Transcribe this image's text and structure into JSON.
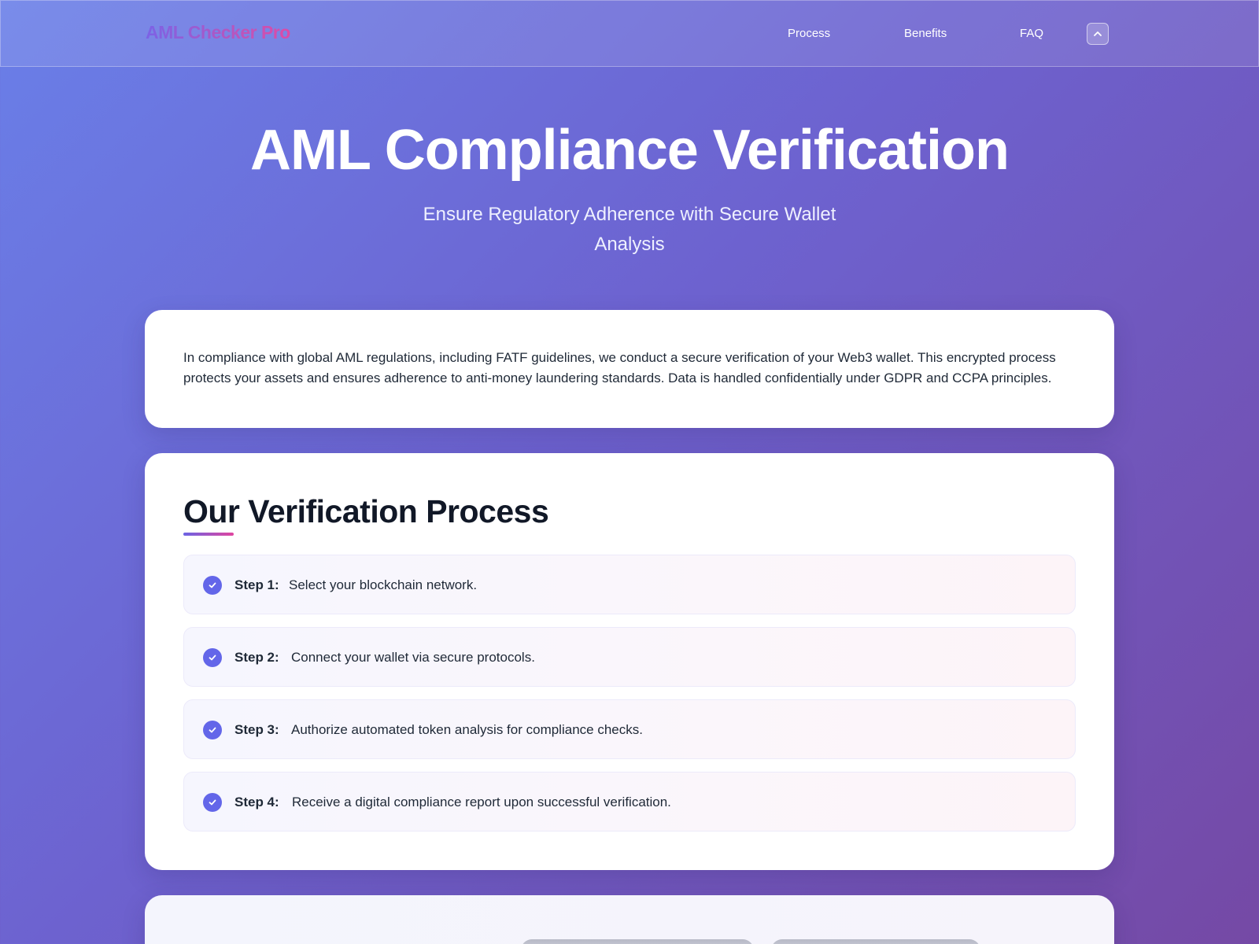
{
  "header": {
    "brand": "AML Checker Pro",
    "nav": [
      {
        "label": "Process"
      },
      {
        "label": "Benefits"
      },
      {
        "label": "FAQ"
      }
    ],
    "toggle_icon": "chevron-up-icon"
  },
  "hero": {
    "title": "AML Compliance Verification",
    "subtitle": "Ensure Regulatory Adherence with Secure Wallet Analysis"
  },
  "intro": {
    "text": "In compliance with global AML regulations, including FATF guidelines, we conduct a secure verification of your Web3 wallet. This encrypted process protects your assets and ensures adherence to anti-money laundering standards. Data is handled confidentially under GDPR and CCPA principles."
  },
  "process": {
    "title": "Our Verification Process",
    "steps": [
      {
        "label": "Step 1:",
        "text": "Select your blockchain network."
      },
      {
        "label": "Step 2:",
        "text": "Connect your wallet via secure protocols."
      },
      {
        "label": "Step 3:",
        "text": "Authorize automated token analysis for compliance checks."
      },
      {
        "label": "Step 4:",
        "text": "Receive a digital compliance report upon successful verification."
      }
    ]
  },
  "colors": {
    "accent": "#6366e9",
    "brand_gradient_start": "#7b62e6",
    "brand_gradient_end": "#de4aa6",
    "background_start": "#6a7fe8",
    "background_end": "#7549a5"
  }
}
